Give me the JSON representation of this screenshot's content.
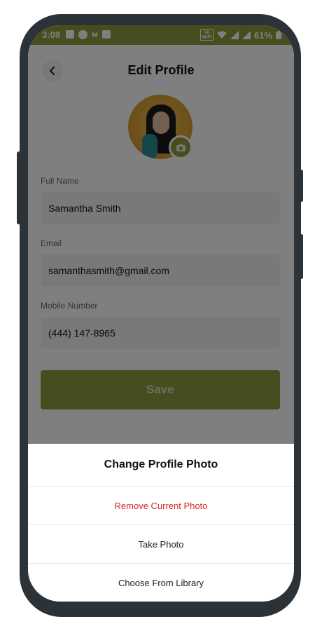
{
  "status_bar": {
    "time": "3:08",
    "volte": "Vo\nWiFi",
    "battery": "61%"
  },
  "header": {
    "title": "Edit Profile"
  },
  "form": {
    "full_name_label": "Full Name",
    "full_name_value": "Samantha Smith",
    "email_label": "Email",
    "email_value": "samanthasmith@gmail.com",
    "mobile_label": "Mobile Number",
    "mobile_value": "(444) 147-8965",
    "save_label": "Save"
  },
  "action_sheet": {
    "title": "Change Profile Photo",
    "items": [
      {
        "label": "Remove Current Photo"
      },
      {
        "label": "Take Photo"
      },
      {
        "label": "Choose From Library"
      }
    ]
  },
  "colors": {
    "accent": "#8f9a3f",
    "danger": "#d9262b",
    "device_frame": "#2b3238"
  },
  "icons": {
    "back": "chevron-left-icon",
    "camera": "camera-icon"
  }
}
